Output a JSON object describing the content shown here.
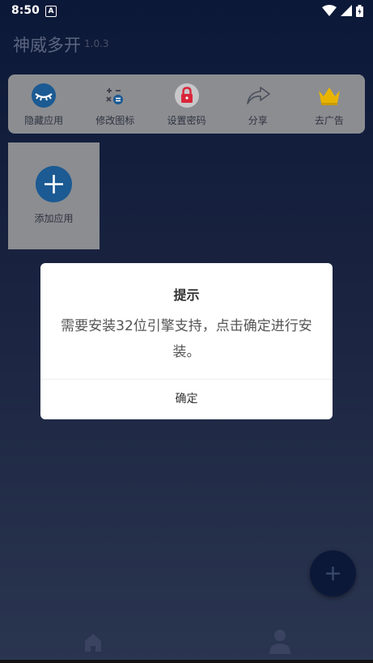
{
  "status_bar": {
    "time": "8:50",
    "notification_icon": "a-icon",
    "notification_letter": "A"
  },
  "app": {
    "title": "神威多开",
    "version": "1.0.3"
  },
  "toolbar": {
    "items": [
      {
        "label": "隐藏应用",
        "icon": "eye-closed-icon"
      },
      {
        "label": "修改图标",
        "icon": "calculator-icon"
      },
      {
        "label": "设置密码",
        "icon": "lock-icon"
      },
      {
        "label": "分享",
        "icon": "share-icon"
      },
      {
        "label": "去广告",
        "icon": "crown-icon"
      }
    ]
  },
  "add_app": {
    "label": "添加应用"
  },
  "dialog": {
    "title": "提示",
    "message": "需要安装32位引擎支持，点击确定进行安装。",
    "confirm_label": "确定"
  },
  "colors": {
    "background_top": "#0b1838",
    "card": "#8b8d91",
    "accent_blue": "#1b5a93",
    "lock_red": "#d9263a",
    "crown_gold": "#e8b400"
  }
}
